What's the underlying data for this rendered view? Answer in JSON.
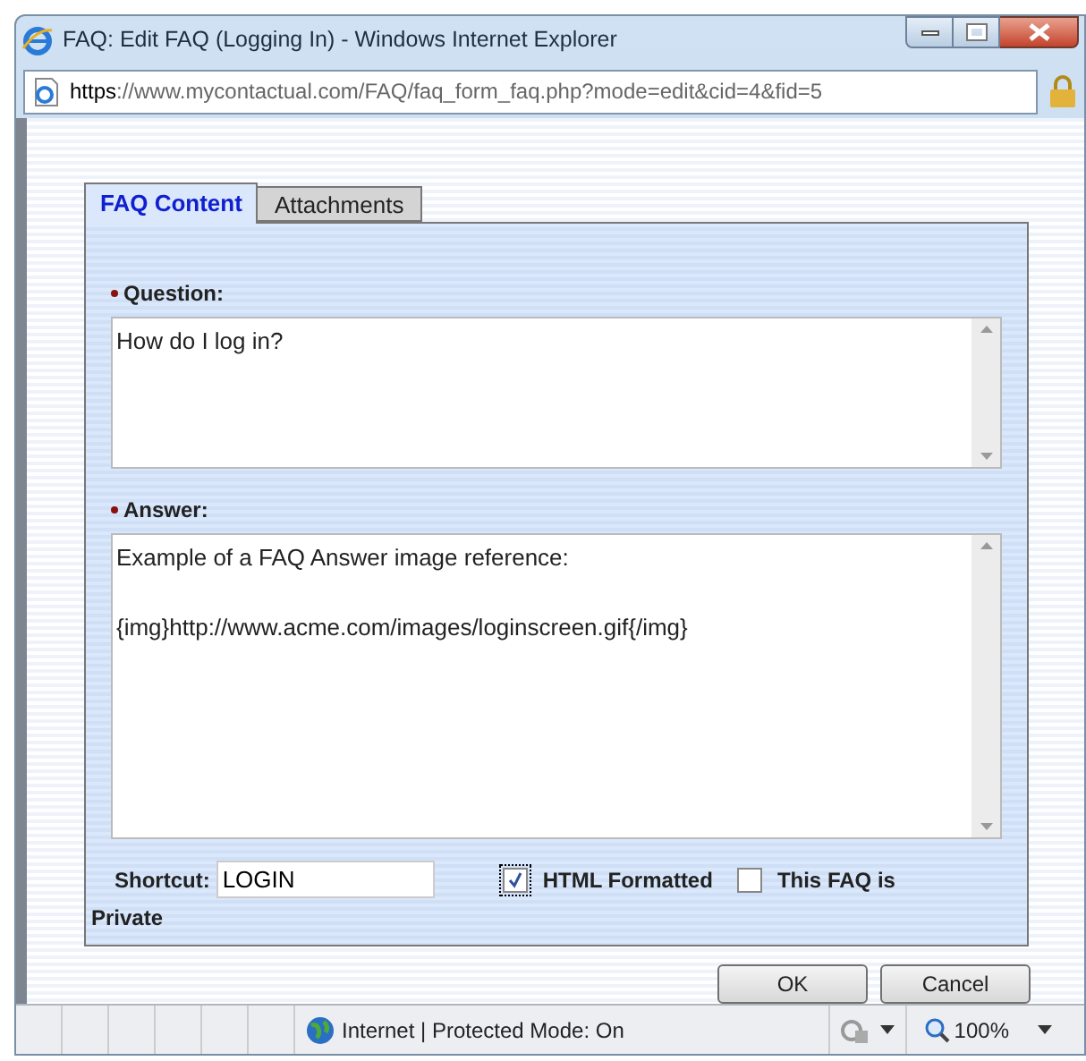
{
  "window": {
    "title": "FAQ: Edit FAQ (Logging In) - Windows Internet Explorer"
  },
  "address_bar": {
    "url_scheme": "https",
    "url_host": "://www.mycontactual.com",
    "url_path": "/FAQ/faq_form_faq.php?mode=edit&cid=4&fid=5"
  },
  "tabs": [
    {
      "label": "FAQ Content",
      "selected": true
    },
    {
      "label": "Attachments",
      "selected": false
    }
  ],
  "fields": [
    {
      "label": "Question:",
      "required": true,
      "value": "How do I log in?"
    },
    {
      "label": "Answer:",
      "required": true,
      "value": "Example of a FAQ Answer image reference:\n\n{img}http://www.acme.com/images/loginscreen.gif{/img}"
    }
  ],
  "shortcut": {
    "label": "Shortcut:",
    "value": "LOGIN"
  },
  "options": [
    {
      "label": "HTML Formatted",
      "checked": true,
      "focused": true
    },
    {
      "label": "This FAQ is",
      "checked": false,
      "focused": false
    }
  ],
  "wrapped_text": "Private",
  "buttons": [
    "OK",
    "Cancel"
  ],
  "status_bar": {
    "zone": "Internet | Protected Mode: On",
    "zoom": "100%"
  }
}
